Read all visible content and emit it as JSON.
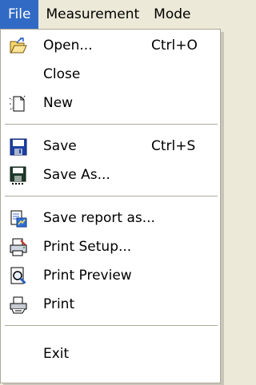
{
  "menubar": {
    "items": [
      {
        "label": "File"
      },
      {
        "label": "Measurement"
      },
      {
        "label": "Mode"
      }
    ]
  },
  "file_menu": {
    "open": {
      "label": "Open...",
      "shortcut": "Ctrl+O",
      "icon": "open-folder-icon"
    },
    "close": {
      "label": "Close"
    },
    "new": {
      "label": "New",
      "icon": "new-document-icon"
    },
    "save": {
      "label": "Save",
      "shortcut": "Ctrl+S",
      "icon": "floppy-disk-icon"
    },
    "save_as": {
      "label": "Save As...",
      "icon": "floppy-disk-icon"
    },
    "save_report": {
      "label": "Save report as...",
      "icon": "report-icon"
    },
    "print_setup": {
      "label": "Print Setup...",
      "icon": "print-setup-icon"
    },
    "print_preview": {
      "label": "Print Preview",
      "icon": "print-preview-icon"
    },
    "print": {
      "label": "Print",
      "icon": "printer-icon"
    },
    "exit": {
      "label": "Exit"
    }
  },
  "colors": {
    "active_menu_bg": "#316ac5",
    "menu_bg": "#ffffff",
    "menubar_bg": "#ece9d8"
  }
}
